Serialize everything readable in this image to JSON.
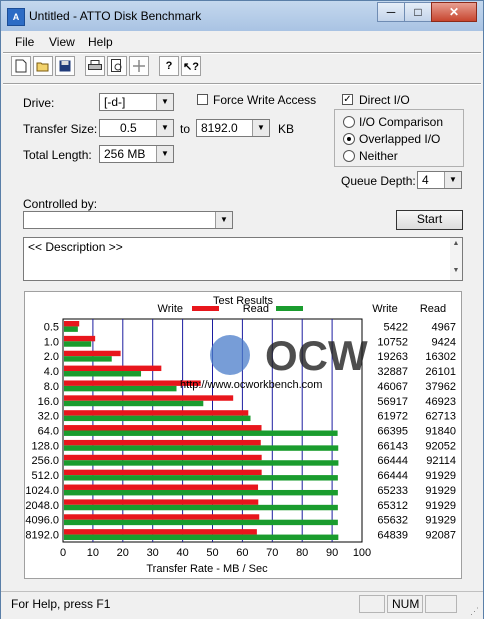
{
  "window": {
    "title": "Untitled - ATTO Disk Benchmark",
    "minimize": "─",
    "maximize": "□",
    "close": "✕"
  },
  "menu": [
    "File",
    "View",
    "Help"
  ],
  "toolbar_icons": [
    "new-icon",
    "open-icon",
    "save-icon",
    "print-icon",
    "print-preview-icon",
    "move-icon",
    "help-icon",
    "context-help-icon"
  ],
  "settings": {
    "drive_label": "Drive:",
    "drive_value": "[-d-]",
    "force_write_label": "Force Write Access",
    "direct_io_label": "Direct I/O",
    "direct_io_checked": true,
    "transfer_size_label": "Transfer Size:",
    "transfer_from": "0.5",
    "to_label": "to",
    "transfer_to": "8192.0",
    "kb_label": "KB",
    "total_length_label": "Total Length:",
    "total_length_value": "256 MB",
    "io_comparison_label": "I/O Comparison",
    "overlapped_label": "Overlapped I/O",
    "neither_label": "Neither",
    "selected_mode": "overlapped",
    "queue_depth_label": "Queue Depth:",
    "queue_depth_value": "4",
    "controlled_by_label": "Controlled by:",
    "controlled_by_value": "",
    "start_label": "Start",
    "description_text": "<< Description >>"
  },
  "results": {
    "title": "Test Results",
    "legend_write": "Write",
    "legend_read": "Read",
    "col_write": "Write",
    "col_read": "Read",
    "watermark_url": "http://www.ocworkbench.com",
    "watermark_logo": "OCW",
    "write_color": "#e8161c",
    "read_color": "#1a9c2e"
  },
  "chart_data": {
    "type": "bar",
    "orientation": "horizontal",
    "categories": [
      "0.5",
      "1.0",
      "2.0",
      "4.0",
      "8.0",
      "16.0",
      "32.0",
      "64.0",
      "128.0",
      "256.0",
      "512.0",
      "1024.0",
      "2048.0",
      "4096.0",
      "8192.0"
    ],
    "series": [
      {
        "name": "Write",
        "values": [
          5422,
          10752,
          19263,
          32887,
          46067,
          56917,
          61972,
          66395,
          66143,
          66444,
          66444,
          65233,
          65312,
          65632,
          64839
        ]
      },
      {
        "name": "Read",
        "values": [
          4967,
          9424,
          16302,
          26101,
          37962,
          46923,
          62713,
          91840,
          92052,
          92114,
          91929,
          91929,
          91929,
          91929,
          92087
        ]
      }
    ],
    "xlabel": "Transfer Rate - MB / Sec",
    "xlim": [
      0,
      100
    ],
    "xticks": [
      "0",
      "10",
      "20",
      "30",
      "40",
      "50",
      "60",
      "70",
      "80",
      "90",
      "100"
    ],
    "grid": true,
    "legend": "top"
  },
  "status": {
    "help_text": "For Help, press F1",
    "num_indicator": "NUM"
  }
}
